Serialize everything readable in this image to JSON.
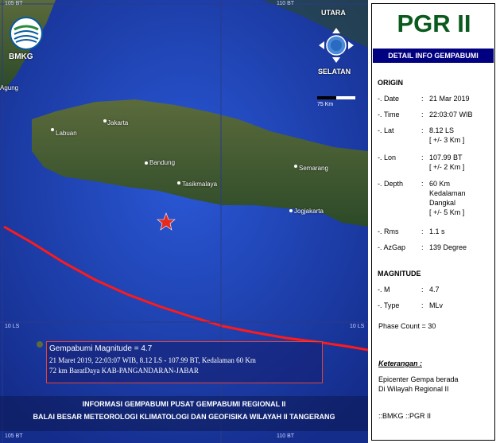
{
  "map": {
    "grid_labels": {
      "top_left": "105 BT",
      "top_right": "110 BT",
      "bottom_left": "105 BT",
      "bottom_right": "110 BT",
      "lat_left": "10 LS",
      "lat_right": "10 LS"
    },
    "cities": [
      "Agung",
      "Labuan",
      "Jakarta",
      "Bandung",
      "Tasikmalaya",
      "Semarang",
      "Jogjakarta"
    ],
    "logo_text": "BMKG",
    "compass": {
      "north": "UTARA",
      "south": "SELATAN"
    },
    "scale": "75 Km",
    "epicenter_box": {
      "line1": "Gempabumi Magnitude = 4.7",
      "line2": "21 Maret 2019, 22:03:07 WIB, 8.12 LS - 107.99 BT, Kedalaman 60 Km",
      "line3": "72 km BaratDaya KAB-PANGANDARAN-JABAR"
    },
    "footer": {
      "line1": "INFORMASI GEMPABUMI PUSAT GEMPABUMI REGIONAL II",
      "line2": "BALAI BESAR METEOROLOGI KLIMATOLOGI DAN GEOFISIKA WILAYAH II TANGERANG"
    },
    "colors": {
      "ocean": "#1a3fb0",
      "land": "#3f5a32",
      "epicenter": "#e52a1e",
      "trench": "#ff1a1a"
    }
  },
  "panel": {
    "title": "PGR II",
    "subtitle": "DETAIL INFO GEMPABUMI",
    "origin_heading": "ORIGIN",
    "date": {
      "key": "-. Date",
      "value": "21 Mar 2019"
    },
    "time": {
      "key": "-. Time",
      "value": "22:03:07 WIB"
    },
    "lat": {
      "key": "-. Lat",
      "value": "8.12 LS",
      "err": "[ +/- 3 Km ]"
    },
    "lon": {
      "key": "-. Lon",
      "value": "107.99 BT",
      "err": "[ +/- 2 Km ]"
    },
    "depth": {
      "key": "-. Depth",
      "value": "60 Km",
      "v2": "Kedalaman",
      "v3": "Dangkal",
      "err": "[ +/- 5 Km ]"
    },
    "rms": {
      "key": "-. Rms",
      "value": "1.1 s"
    },
    "azgap": {
      "key": "-. AzGap",
      "value": "139 Degree"
    },
    "magnitude_heading": "MAGNITUDE",
    "m": {
      "key": "-. M",
      "value": "4.7"
    },
    "type": {
      "key": "-. Type",
      "value": "MLv"
    },
    "phase_count": "Phase Count = 30",
    "keterangan_heading": "Keterangan :",
    "keterangan_l1": "Epicenter Gempa berada",
    "keterangan_l2": "Di Wilayah Regional II",
    "footer": "::BMKG  ::PGR II",
    "colon": ":"
  }
}
